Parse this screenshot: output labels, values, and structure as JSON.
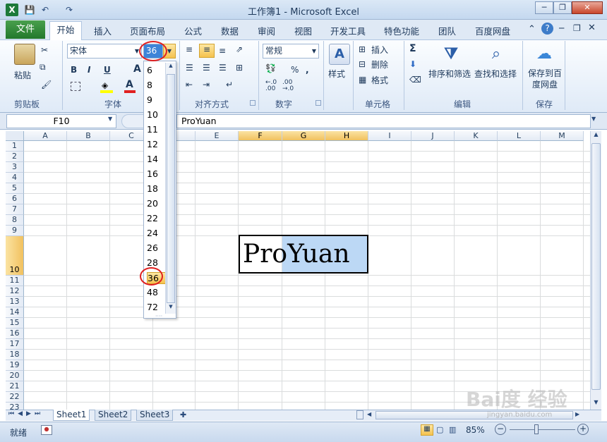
{
  "window": {
    "title": "工作簿1 - Microsoft Excel",
    "app_icon": "X",
    "minimize": "─",
    "restore": "❐",
    "close": "✕"
  },
  "qat": {
    "save": "💾",
    "undo": "↶",
    "redo": "↷"
  },
  "tabs": {
    "file": "文件",
    "home": "开始",
    "insert": "插入",
    "layout": "页面布局",
    "formulas": "公式",
    "data": "数据",
    "review": "审阅",
    "view": "视图",
    "developer": "开发工具",
    "special": "特色功能",
    "team": "团队",
    "baidu": "百度网盘"
  },
  "clipboard": {
    "paste": "粘贴",
    "label": "剪贴板"
  },
  "font": {
    "name": "宋体",
    "size": "36",
    "bold": "B",
    "italic": "I",
    "underline": "U",
    "grow": "A",
    "label": "字体"
  },
  "alignment": {
    "label": "对齐方式"
  },
  "number": {
    "format": "常规",
    "percent": "%",
    "decimals_up": "←.0\n.00",
    "decimals_down": ".00\n→.0",
    "label": "数字"
  },
  "styles": {
    "label": "样式"
  },
  "cells": {
    "insert": "插入",
    "delete": "删除",
    "format": "格式",
    "label": "单元格"
  },
  "editing": {
    "sort": "排序和筛选",
    "find": "查找和选择",
    "label": "编辑",
    "sigma": "Σ"
  },
  "save": {
    "save_baidu": "保存到百度网盘",
    "label": "保存"
  },
  "formula_bar": {
    "name_box": "F10",
    "content": "ProYuan"
  },
  "columns": [
    "A",
    "B",
    "C",
    "D",
    "E",
    "F",
    "G",
    "H",
    "I",
    "J",
    "K",
    "L",
    "M"
  ],
  "rows": [
    "1",
    "2",
    "3",
    "4",
    "5",
    "6",
    "7",
    "8",
    "9",
    "10",
    "11",
    "12",
    "13",
    "14",
    "15",
    "16",
    "17",
    "18",
    "19",
    "20",
    "21",
    "22",
    "23"
  ],
  "cell": {
    "text": "ProYuan"
  },
  "size_options": [
    "6",
    "8",
    "9",
    "10",
    "11",
    "12",
    "14",
    "16",
    "18",
    "20",
    "22",
    "24",
    "26",
    "28",
    "36",
    "48",
    "72"
  ],
  "sheets": [
    "Sheet1",
    "Sheet2",
    "Sheet3"
  ],
  "status": {
    "ready": "就绪",
    "zoom": "85%"
  },
  "watermark": {
    "text": "Bai度 经验",
    "url": "jingyan.baidu.com"
  }
}
